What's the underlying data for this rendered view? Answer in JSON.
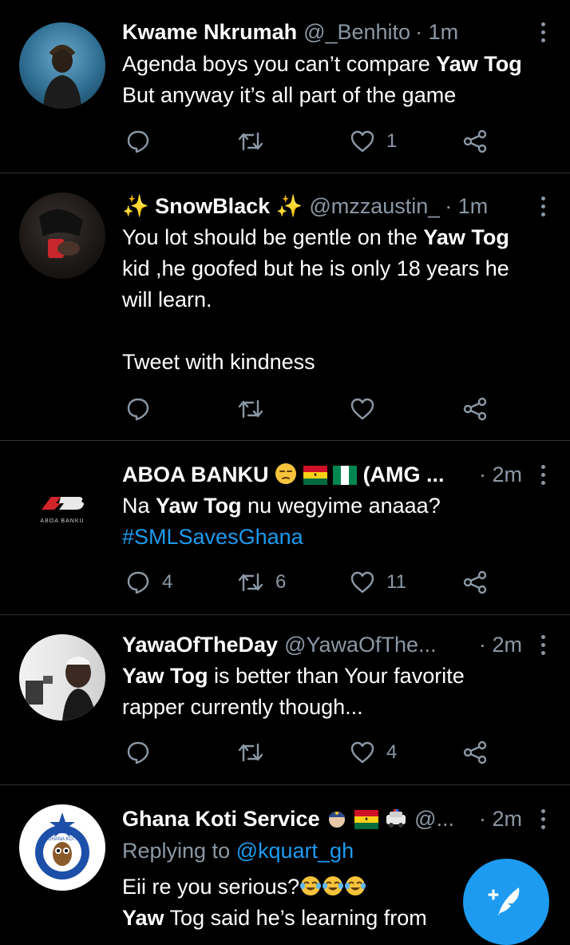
{
  "tweets": [
    {
      "name": "Kwame Nkrumah",
      "handle": "@_Benhito",
      "time": "· 1m",
      "lines": [
        {
          "pre": "Agenda boys you can’t compare ",
          "bold": "Yaw Tog",
          "post": ""
        },
        {
          "pre": "But anyway it’s all part of the game",
          "bold": "",
          "post": ""
        }
      ],
      "reply_count": "",
      "retweet_count": "",
      "like_count": "1"
    },
    {
      "name": "SnowBlack",
      "name_decoration": "✨",
      "handle": "@mzzaustin_",
      "time": "· 1m",
      "lines": [
        {
          "pre": "You lot should be gentle on the ",
          "bold": "Yaw Tog",
          "post": ""
        },
        {
          "pre": "kid ,he goofed but he is only 18 years he",
          "bold": "",
          "post": ""
        },
        {
          "pre": "will learn.",
          "bold": "",
          "post": ""
        },
        {
          "pre": "",
          "bold": "",
          "post": ""
        },
        {
          "pre": "Tweet with kindness",
          "bold": "",
          "post": ""
        }
      ],
      "reply_count": "",
      "retweet_count": "",
      "like_count": ""
    },
    {
      "name": "ABOA BANKU",
      "name_suffix": "(AMG ...",
      "handle": "",
      "time": "· 2m",
      "avatar_text": "ABOA BANKU",
      "lines": [
        {
          "pre": "Na ",
          "bold": "Yaw Tog",
          "post": " nu wegyime anaaa?"
        }
      ],
      "hashtag": "#SMLSavesGhana",
      "reply_count": "4",
      "retweet_count": "6",
      "like_count": "11"
    },
    {
      "name": "YawaOfTheDay",
      "handle": "@YawaOfThe...",
      "time": "· 2m",
      "lines": [
        {
          "pre": "",
          "bold": "Yaw Tog",
          "post": " is better than Your favorite"
        },
        {
          "pre": "rapper currently though...",
          "bold": "",
          "post": ""
        }
      ],
      "reply_count": "",
      "retweet_count": "",
      "like_count": "4"
    },
    {
      "name": "Ghana Koti Service",
      "handle": "@...",
      "time": "· 2m",
      "avatar_text": "GHANA KOTI",
      "replying_prefix": "Replying to ",
      "replying_handle": "@kquart_gh",
      "lines": [
        {
          "pre": "Eii re you serious?",
          "bold": "",
          "post": ""
        },
        {
          "pre": "",
          "bold": "Yaw",
          "post": " Tog said he’s learning from"
        }
      ]
    }
  ],
  "colors": {
    "background": "#000000",
    "text": "#ffffff",
    "muted": "#8b98a5",
    "accent": "#1d9bf0",
    "divider": "#2f3336"
  },
  "icons": {
    "reply": "reply-icon",
    "retweet": "retweet-icon",
    "like": "heart-icon",
    "share": "share-icon",
    "more": "more-vertical-icon",
    "compose": "compose-tweet-icon"
  }
}
